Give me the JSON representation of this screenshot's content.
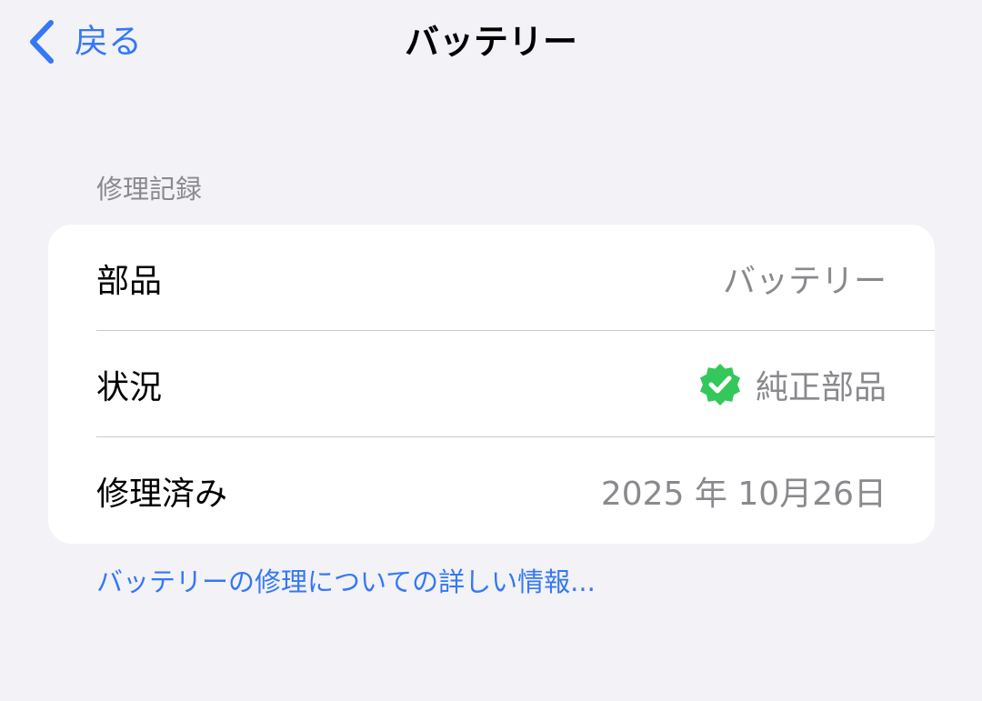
{
  "nav": {
    "back_label": "戻る",
    "title": "バッテリー"
  },
  "section": {
    "header": "修理記録",
    "rows": [
      {
        "label": "部品",
        "value": "バッテリー"
      },
      {
        "label": "状況",
        "value": "純正部品",
        "icon": "verified-badge-icon",
        "icon_color": "#34c759"
      },
      {
        "label": "修理済み",
        "value": "2025 年 10月26日"
      }
    ],
    "footer_link": "バッテリーの修理についての詳しい情報..."
  },
  "colors": {
    "accent": "#3478f6",
    "background": "#f2f2f7",
    "secondary_text": "#8a8a8e",
    "badge": "#34c759"
  }
}
